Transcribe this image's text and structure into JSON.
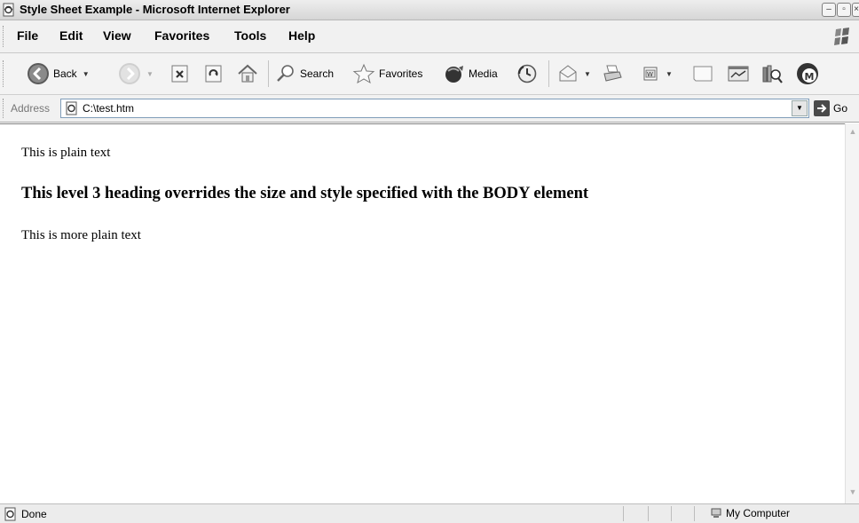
{
  "window": {
    "title": "Style Sheet Example - Microsoft Internet Explorer",
    "icon": "ie-page-icon"
  },
  "menu": {
    "items": [
      "File",
      "Edit",
      "View",
      "Favorites",
      "Tools",
      "Help"
    ]
  },
  "toolbar": {
    "back_label": "Back",
    "search_label": "Search",
    "favorites_label": "Favorites",
    "media_label": "Media"
  },
  "address": {
    "label": "Address",
    "value": "C:\\test.htm",
    "go_label": "Go"
  },
  "document": {
    "plain_text": "This is plain text",
    "heading": "This level 3 heading overrides the size and style specified with the BODY element",
    "more_text": "This is more plain text"
  },
  "status": {
    "text": "Done",
    "zone": "My Computer"
  },
  "colors": {
    "back_button": "#3b8a3b",
    "forward_button": "#b0b0b0",
    "address_border": "#7f9db9"
  }
}
